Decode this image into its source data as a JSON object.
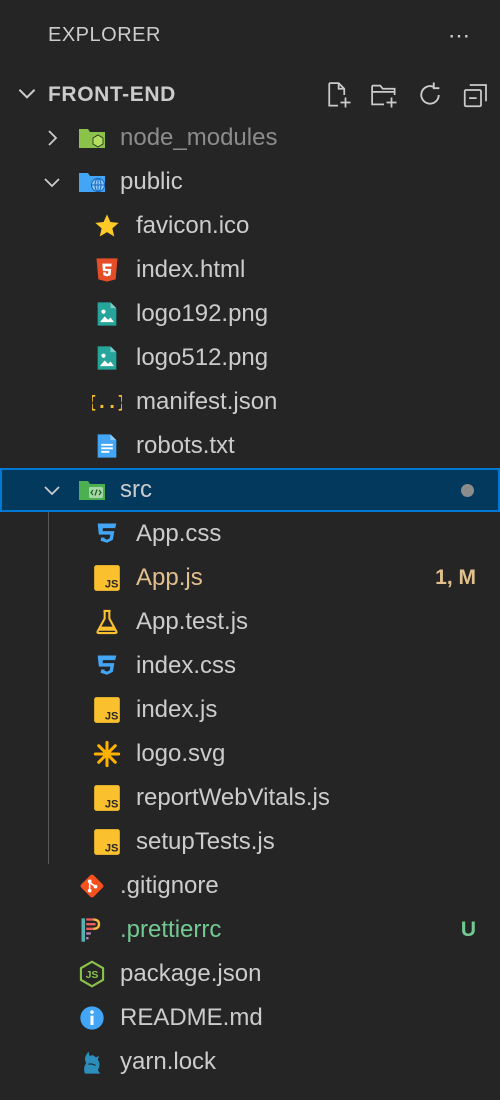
{
  "header": {
    "title": "EXPLORER",
    "more_icon": "ellipsis-icon"
  },
  "section": {
    "title": "FRONT-END",
    "actions": [
      "new-file-icon",
      "new-folder-icon",
      "refresh-icon",
      "collapse-all-icon"
    ]
  },
  "tree": [
    {
      "label": "node_modules",
      "icon": "folder-node-icon",
      "depth": 0,
      "twist": "right",
      "style": "dim"
    },
    {
      "label": "public",
      "icon": "folder-public-icon",
      "depth": 0,
      "twist": "down"
    },
    {
      "label": "favicon.ico",
      "icon": "star-icon",
      "depth": 1
    },
    {
      "label": "index.html",
      "icon": "html5-icon",
      "depth": 1
    },
    {
      "label": "logo192.png",
      "icon": "image-icon",
      "depth": 1
    },
    {
      "label": "logo512.png",
      "icon": "image-icon",
      "depth": 1
    },
    {
      "label": "manifest.json",
      "icon": "json-icon",
      "depth": 1
    },
    {
      "label": "robots.txt",
      "icon": "text-file-icon",
      "depth": 1
    },
    {
      "label": "src",
      "icon": "folder-src-icon",
      "depth": 0,
      "twist": "down",
      "selected": true,
      "dot": true
    },
    {
      "label": "App.css",
      "icon": "css-icon",
      "depth": 1
    },
    {
      "label": "App.js",
      "icon": "js-icon",
      "depth": 1,
      "style": "mod",
      "badge": "1, M"
    },
    {
      "label": "App.test.js",
      "icon": "test-flask-icon",
      "depth": 1
    },
    {
      "label": "index.css",
      "icon": "css-icon",
      "depth": 1
    },
    {
      "label": "index.js",
      "icon": "js-icon",
      "depth": 1
    },
    {
      "label": "logo.svg",
      "icon": "svg-asterisk-icon",
      "depth": 1
    },
    {
      "label": "reportWebVitals.js",
      "icon": "js-icon",
      "depth": 1
    },
    {
      "label": "setupTests.js",
      "icon": "js-icon",
      "depth": 1
    },
    {
      "label": ".gitignore",
      "icon": "git-icon",
      "depth": 0
    },
    {
      "label": ".prettierrc",
      "icon": "prettier-icon",
      "depth": 0,
      "style": "untracked",
      "badge": "U"
    },
    {
      "label": "package.json",
      "icon": "nodejs-icon",
      "depth": 0
    },
    {
      "label": "README.md",
      "icon": "info-icon",
      "depth": 0
    },
    {
      "label": "yarn.lock",
      "icon": "yarn-icon",
      "depth": 0
    }
  ],
  "colors": {
    "background": "#252526",
    "selection": "#04395e",
    "focus_border": "#0078d4",
    "modified": "#e2c08d",
    "untracked": "#73c991"
  }
}
